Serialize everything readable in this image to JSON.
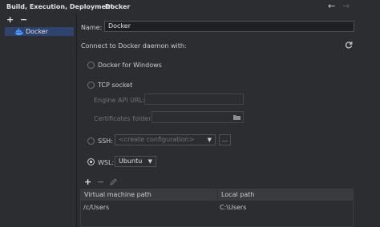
{
  "breadcrumb": {
    "section": "Build, Execution, Deployment",
    "separator": "›",
    "page": "Docker"
  },
  "nav": {
    "back": "←",
    "forward": "→"
  },
  "left_toolbar": {
    "add": "+",
    "remove": "−"
  },
  "tree": {
    "items": [
      {
        "label": "Docker",
        "icon": "docker-whale-icon",
        "selected": true
      }
    ]
  },
  "form": {
    "name_label": "Name:",
    "name_value": "Docker",
    "connect_label": "Connect to Docker daemon with:",
    "refresh_icon": "refresh-icon",
    "options": {
      "docker_for_windows": "Docker for Windows",
      "tcp_socket": "TCP socket",
      "engine_api_url_label": "Engine API URL:",
      "engine_api_url_value": "",
      "certificates_folder_label": "Certificates folder:",
      "certificates_folder_value": "",
      "ssh_label": "SSH:",
      "ssh_placeholder": "<create configuration>",
      "ssh_more": "...",
      "wsl_label": "WSL:",
      "wsl_value": "Ubuntu"
    },
    "selected_option": "wsl"
  },
  "mappings_toolbar": {
    "add": "+",
    "remove": "−",
    "edit_icon": "pencil-icon"
  },
  "mappings_table": {
    "columns": [
      "Virtual machine path",
      "Local path"
    ],
    "rows": [
      [
        "/c/Users",
        "C:\\Users"
      ]
    ]
  },
  "colors": {
    "selection": "#2e436e",
    "background": "#2b2d30",
    "field": "#1e1f22",
    "accent_docker": "#4a9eff"
  }
}
